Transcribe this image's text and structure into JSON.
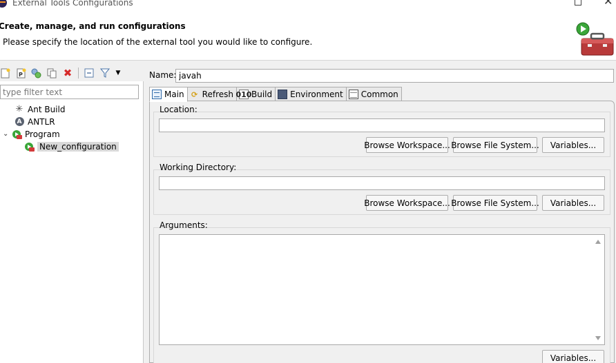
{
  "window": {
    "title": "External Tools Configurations",
    "icons": [
      "eclipse-app-icon",
      "maximize-icon",
      "close-icon"
    ]
  },
  "header": {
    "heading": "Create, manage, and run configurations",
    "message": "Please specify the location of the external tool you would like to configure.",
    "icon": "toolbox-run-icon"
  },
  "left_toolbar": {
    "buttons": [
      "new-configuration-icon",
      "new-prototype-icon",
      "export-icon",
      "duplicate-icon",
      "delete-icon",
      "collapse-all-icon",
      "filter-icon",
      "view-menu-icon"
    ]
  },
  "filter": {
    "placeholder": "type filter text",
    "value": ""
  },
  "tree": {
    "items": [
      {
        "label": "Ant Build",
        "icon": "ant-icon",
        "level": 1
      },
      {
        "label": "ANTLR",
        "icon": "antlr-icon",
        "level": 1
      },
      {
        "label": "Program",
        "icon": "program-icon",
        "level": 1,
        "expanded": true
      },
      {
        "label": "New_configuration",
        "icon": "program-config-icon",
        "level": 2,
        "selected": true
      }
    ]
  },
  "form": {
    "name_label": "Name:",
    "name_value": "javah"
  },
  "tabs": [
    {
      "label": "Main",
      "icon": "main-tab-icon",
      "active": true
    },
    {
      "label": "Refresh",
      "icon": "refresh-icon"
    },
    {
      "label": "Build",
      "icon": "build-icon"
    },
    {
      "label": "Environment",
      "icon": "environment-icon"
    },
    {
      "label": "Common",
      "icon": "common-icon"
    }
  ],
  "main": {
    "location": {
      "label": "Location:",
      "value": "",
      "browse_workspace": "Browse Workspace...",
      "browse_file_system": "Browse File System...",
      "variables": "Variables..."
    },
    "working_directory": {
      "label": "Working Directory:",
      "value": "",
      "browse_workspace": "Browse Workspace...",
      "browse_file_system": "Browse File System...",
      "variables": "Variables..."
    },
    "arguments": {
      "label": "Arguments:",
      "value": "",
      "variables": "Variables..."
    }
  },
  "colors": {
    "background": "#f0f0f0",
    "selection": "#d9d9d9",
    "border": "#adadad"
  }
}
